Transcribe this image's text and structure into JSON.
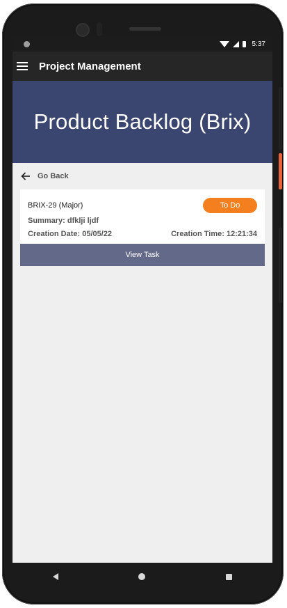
{
  "status_bar": {
    "time": "5:37"
  },
  "appbar": {
    "title": "Project Management"
  },
  "hero": {
    "title": "Product Backlog (Brix)"
  },
  "nav": {
    "go_back_label": "Go Back"
  },
  "task": {
    "key": "BRIX-29 (Major)",
    "status": "To Do",
    "summary": "Summary: dfklji ljdf",
    "creation_date": "Creation Date: 05/05/22",
    "creation_time": "Creation Time: 12:21:34",
    "view_label": "View Task"
  },
  "colors": {
    "appbar": "#262626",
    "hero": "#3a4570",
    "status_badge": "#f47f1f",
    "view_button": "#636988"
  }
}
